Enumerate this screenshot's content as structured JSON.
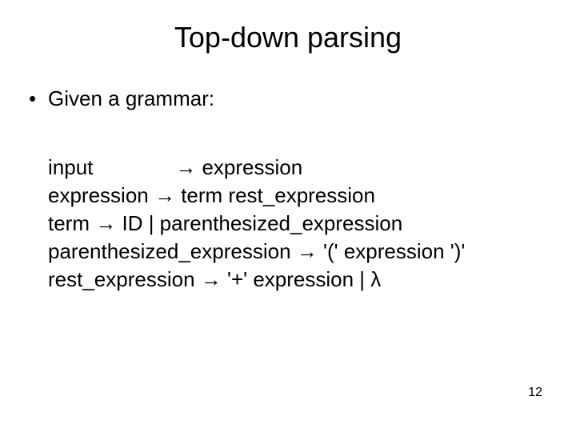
{
  "title": "Top-down parsing",
  "bullet": {
    "marker": "•",
    "text": "Given a grammar:"
  },
  "grammar": {
    "l1": {
      "lhs": "input",
      "arrow": "→",
      "rhs": "expression"
    },
    "l2": {
      "lhs": "expression ",
      "arrow": "→",
      "rhs": "term rest_expression"
    },
    "l3": {
      "lhs": "term ",
      "arrow": "→",
      "rhs": "ID | parenthesized_expression"
    },
    "l4": {
      "lhs": "parenthesized_expression ",
      "arrow": "→",
      "rhs": "'(' expression ')'"
    },
    "l5": {
      "lhs": "rest_expression ",
      "arrow": "→",
      "rhs": "'+' expression | λ"
    }
  },
  "page_number": "12"
}
